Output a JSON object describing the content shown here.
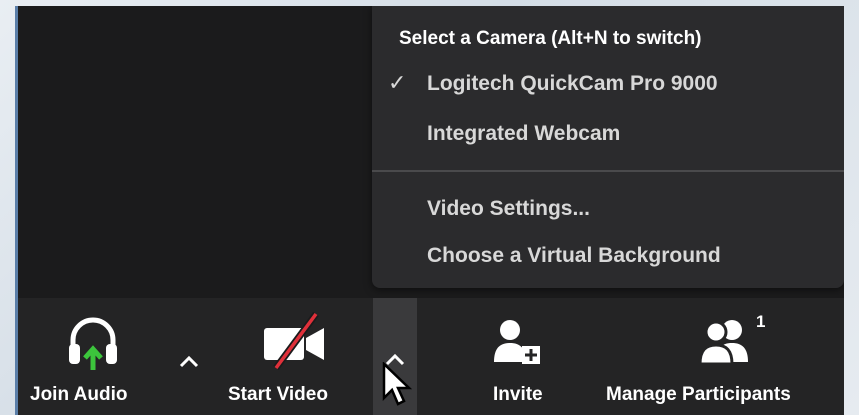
{
  "camera_menu": {
    "title": "Select a Camera (Alt+N to switch)",
    "cameras": [
      {
        "label": "Logitech QuickCam Pro 9000",
        "selected": true
      },
      {
        "label": "Integrated Webcam",
        "selected": false
      }
    ],
    "check_glyph": "✓",
    "video_settings": "Video Settings...",
    "virtual_background": "Choose a Virtual Background"
  },
  "toolbar": {
    "join_audio": {
      "label": "Join Audio",
      "icon": "headphones-icon",
      "arrow_color": "#3cc53c"
    },
    "start_video": {
      "label": "Start Video",
      "icon": "video-off-icon",
      "slash_color": "#e0303a"
    },
    "invite": {
      "label": "Invite",
      "icon": "add-user-icon"
    },
    "manage_participants": {
      "label": "Manage Participants",
      "icon": "participants-icon",
      "count": "1"
    }
  },
  "colors": {
    "window_bg": "#1b1b1c",
    "toolbar_bg": "#242425",
    "menu_bg": "#2b2b2d",
    "text": "#ffffff"
  }
}
